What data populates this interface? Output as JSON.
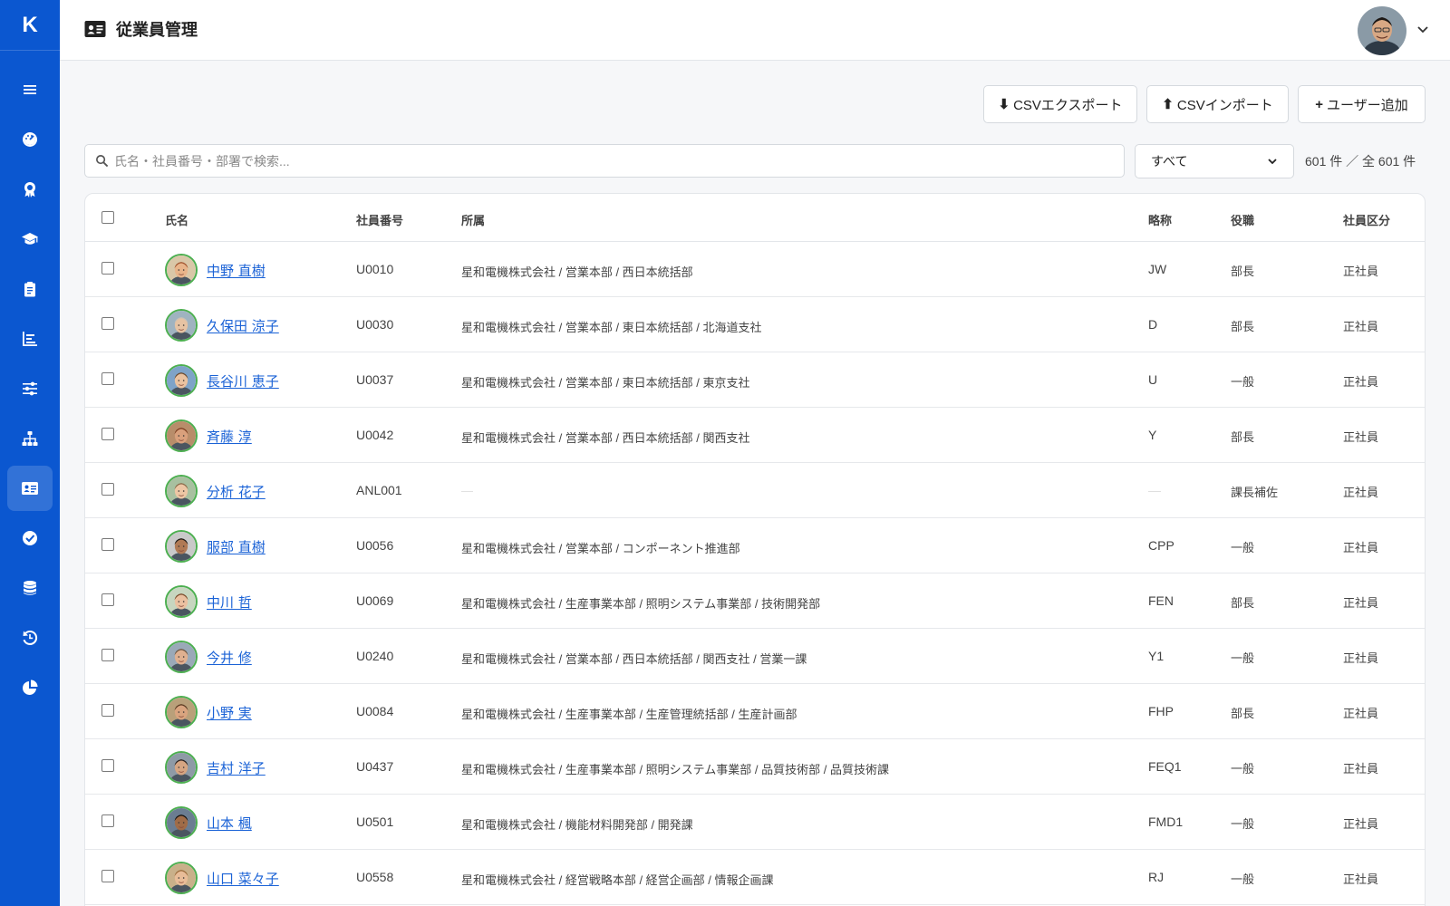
{
  "sidebar": {
    "logo": "K",
    "items": [
      {
        "icon": "menu-icon"
      },
      {
        "icon": "dashboard-icon"
      },
      {
        "icon": "award-icon"
      },
      {
        "icon": "graduation-cap-icon"
      },
      {
        "icon": "clipboard-icon"
      },
      {
        "icon": "bar-chart-icon"
      },
      {
        "icon": "sliders-icon"
      },
      {
        "icon": "org-chart-icon"
      },
      {
        "icon": "id-card-icon",
        "active": true
      },
      {
        "icon": "check-circle-icon"
      },
      {
        "icon": "database-icon"
      },
      {
        "icon": "history-icon"
      },
      {
        "icon": "pie-chart-icon"
      }
    ]
  },
  "header": {
    "title": "従業員管理",
    "title_icon": "id-card-icon"
  },
  "toolbar": {
    "export_label": "CSVエクスポート",
    "import_label": "CSVインポート",
    "add_user_label": "ユーザー追加",
    "export_glyph": "⬇",
    "import_glyph": "⬆",
    "add_glyph": "+"
  },
  "search": {
    "placeholder": "氏名・社員番号・部署で検索...",
    "value": ""
  },
  "filter": {
    "selected": "すべて"
  },
  "count_text": "601 件 ／ 全 601 件",
  "table": {
    "headers": {
      "name": "氏名",
      "emp_no": "社員番号",
      "org": "所属",
      "abbr": "略称",
      "position": "役職",
      "type": "社員区分"
    },
    "rows": [
      {
        "name": "中野 直樹",
        "emp_no": "U0010",
        "org": "星和電機株式会社 / 営業本部 / 西日本統括部",
        "abbr": "JW",
        "position": "部長",
        "type": "正社員",
        "skin": "#e8b48a",
        "hair": "#a0522d",
        "bg": "#d9c7a8"
      },
      {
        "name": "久保田 涼子",
        "emp_no": "U0030",
        "org": "星和電機株式会社 / 営業本部 / 東日本統括部 / 北海道支社",
        "abbr": "D",
        "position": "部長",
        "type": "正社員",
        "skin": "#e6c3a3",
        "hair": "#c9c1b6",
        "bg": "#9fb3c0"
      },
      {
        "name": "長谷川 恵子",
        "emp_no": "U0037",
        "org": "星和電機株式会社 / 営業本部 / 東日本統括部 / 東京支社",
        "abbr": "U",
        "position": "一般",
        "type": "正社員",
        "skin": "#eac2a0",
        "hair": "#6b4a2e",
        "bg": "#7ea3c8"
      },
      {
        "name": "斉藤 淳",
        "emp_no": "U0042",
        "org": "星和電機株式会社 / 営業本部 / 西日本統括部 / 関西支社",
        "abbr": "Y",
        "position": "部長",
        "type": "正社員",
        "skin": "#d9a07c",
        "hair": "#7a3b1f",
        "bg": "#b88d6a"
      },
      {
        "name": "分析 花子",
        "emp_no": "ANL001",
        "org": "—",
        "abbr": "—",
        "position": "課長補佐",
        "type": "正社員",
        "skin": "#edc6a4",
        "hair": "#8b6b4a",
        "bg": "#a8c0a0"
      },
      {
        "name": "服部 直樹",
        "emp_no": "U0056",
        "org": "星和電機株式会社 / 営業本部 / コンポーネント推進部",
        "abbr": "CPP",
        "position": "一般",
        "type": "正社員",
        "skin": "#b07a55",
        "hair": "#1f1a16",
        "bg": "#c9c9c9"
      },
      {
        "name": "中川 哲",
        "emp_no": "U0069",
        "org": "星和電機株式会社 / 生産事業本部 / 照明システム事業部 / 技術開発部",
        "abbr": "FEN",
        "position": "部長",
        "type": "正社員",
        "skin": "#eac0a0",
        "hair": "#7a4a2a",
        "bg": "#c7d6c0"
      },
      {
        "name": "今井 修",
        "emp_no": "U0240",
        "org": "星和電機株式会社 / 営業本部 / 西日本統括部 / 関西支社 / 営業一課",
        "abbr": "Y1",
        "position": "一般",
        "type": "正社員",
        "skin": "#e0b090",
        "hair": "#6b5440",
        "bg": "#9aa9b8"
      },
      {
        "name": "小野 実",
        "emp_no": "U0084",
        "org": "星和電機株式会社 / 生産事業本部 / 生産管理統括部 / 生産計画部",
        "abbr": "FHP",
        "position": "部長",
        "type": "正社員",
        "skin": "#d9a47f",
        "hair": "#5b3a22",
        "bg": "#b9a07a"
      },
      {
        "name": "吉村 洋子",
        "emp_no": "U0437",
        "org": "星和電機株式会社 / 生産事業本部 / 照明システム事業部 / 品質技術部 / 品質技術課",
        "abbr": "FEQ1",
        "position": "一般",
        "type": "正社員",
        "skin": "#d6a582",
        "hair": "#2a2220",
        "bg": "#8e9aa6"
      },
      {
        "name": "山本 楓",
        "emp_no": "U0501",
        "org": "星和電機株式会社 / 機能材料開発部 / 開発課",
        "abbr": "FMD1",
        "position": "一般",
        "type": "正社員",
        "skin": "#a06c48",
        "hair": "#151210",
        "bg": "#6b7d92"
      },
      {
        "name": "山口 菜々子",
        "emp_no": "U0558",
        "org": "星和電機株式会社 / 経営戦略本部 / 経営企画部 / 情報企画課",
        "abbr": "RJ",
        "position": "一般",
        "type": "正社員",
        "skin": "#e8bc98",
        "hair": "#9a6a3a",
        "bg": "#c9b08a"
      }
    ]
  }
}
